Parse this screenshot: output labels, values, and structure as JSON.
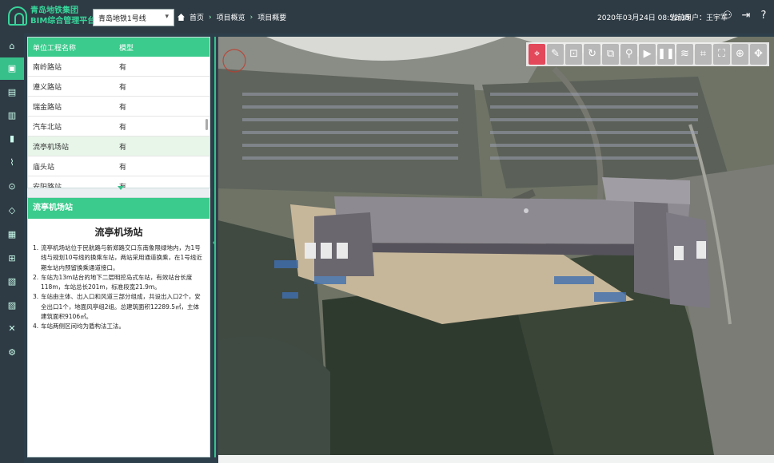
{
  "header": {
    "brand_line1": "青岛地铁集团",
    "brand_line2": "BIM综合管理平台",
    "line_select": "青岛地铁1号线",
    "breadcrumb": [
      "首页",
      "项目概览",
      "项目概要"
    ],
    "datetime": "2020年03月24日 08:52:35",
    "current_user": "当前用户：王宇军",
    "icons": [
      "user-settings-icon",
      "logout-icon",
      "help-icon"
    ]
  },
  "nav": {
    "items": [
      "home-icon",
      "overview-icon",
      "document-icon",
      "inbox-icon",
      "bar-chart-icon",
      "line-chart-icon",
      "location-icon",
      "shield-icon",
      "calendar-icon",
      "org-chart-icon",
      "id-card-icon",
      "report-icon",
      "tools-icon",
      "settings-icon"
    ],
    "active_index": 1
  },
  "unit_table": {
    "headers": [
      "单位工程名称",
      "模型"
    ],
    "rows": [
      {
        "name": "南岭路站",
        "model": "有"
      },
      {
        "name": "遵义路站",
        "model": "有"
      },
      {
        "name": "瑞金路站",
        "model": "有"
      },
      {
        "name": "汽车北站",
        "model": "有"
      },
      {
        "name": "流亭机场站",
        "model": "有"
      },
      {
        "name": "庙头站",
        "model": "有"
      },
      {
        "name": "安阳路站",
        "model": "有"
      }
    ],
    "selected_index": 4
  },
  "station_info": {
    "header": "流亭机场站",
    "title": "流亭机场站",
    "items": [
      "流亭机场站位于民航路与新郑路交口东南象限绿地内，为1号线与规划10号线的换乘车站，两站采用通道换乘，在1号线近期车站内预留换乘通道接口。",
      "车站为13m站台的地下二层明挖岛式车站，有效站台长度118m，车站总长201m，标准段宽21.9m。",
      "车站由主体、出入口和风道三部分组成，共设出入口2个，安全出口1个，地面风亭组2组。总建筑面积12289.5㎡，主体建筑面积9106㎡。",
      "车站两侧区间均为盾构法工法。"
    ]
  },
  "toolbar": {
    "tools": [
      "location-pin-icon",
      "measure-pen-icon",
      "focus-icon",
      "rotate-icon",
      "section-icon",
      "walk-icon",
      "play-icon",
      "pause-icon",
      "layers-icon",
      "crop-icon",
      "fullscreen-icon",
      "target-icon",
      "move-icon"
    ],
    "active_index": 0
  },
  "colors": {
    "accent": "#3bcb8c",
    "topbar": "#2e3b44",
    "tool_active": "#e2475a"
  }
}
